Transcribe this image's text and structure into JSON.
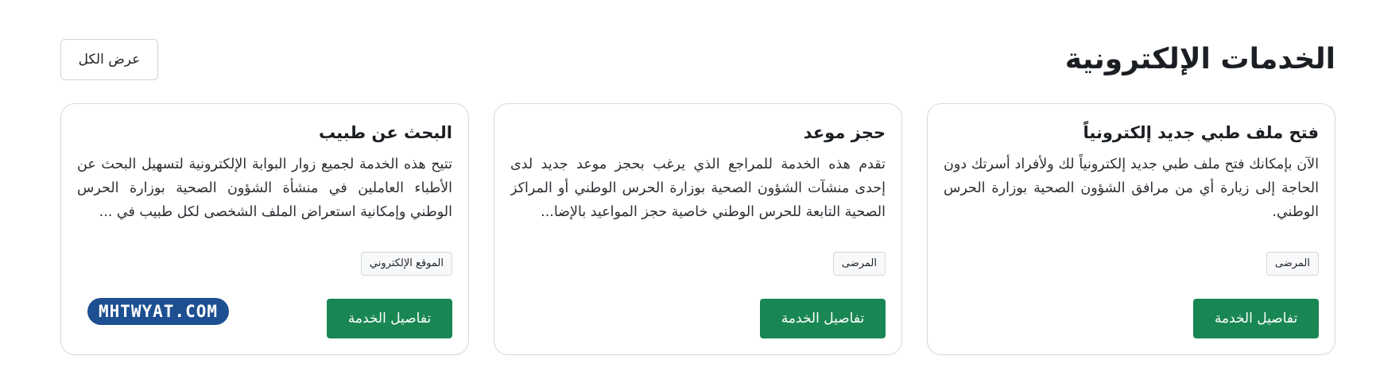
{
  "header": {
    "title": "الخدمات الإلكترونية",
    "view_all_label": "عرض الكل"
  },
  "cards": [
    {
      "title": "فتح ملف طبي جديد إلكترونياً",
      "description": "الآن بإمكانك فتح ملف طبي جديد إلكترونياً لك ولأفراد أسرتك دون الحاجة إلى زيارة أي من مرافق الشؤون الصحية بوزارة الحرس الوطني.",
      "tag": "المرضى",
      "button_label": "تفاصيل الخدمة"
    },
    {
      "title": "حجز موعد",
      "description": "تقدم هذه الخدمة للمراجع الذي يرغب بحجز موعد جديد لدى إحدى منشآت الشؤون الصحية بوزارة الحرس الوطني أو المراكز الصحية التابعة للحرس الوطني خاصية حجز المواعيد بالإضا...",
      "tag": "المرضى",
      "button_label": "تفاصيل الخدمة"
    },
    {
      "title": "البحث عن طبيب",
      "description": "تتيح هذه الخدمة لجميع زوار البوابة الإلكترونية لتسهيل البحث عن الأطباء العاملين في منشأة الشؤون الصحية بوزارة الحرس الوطني وإمكانية استعراض الملف الشخصى لكل طبيب في ...",
      "tag": "الموقع الإلكتروني",
      "button_label": "تفاصيل الخدمة"
    }
  ],
  "watermark": {
    "text": "MHTWYAT.COM"
  },
  "colors": {
    "primary_button": "#198754",
    "watermark_bg": "#1d4f91"
  }
}
